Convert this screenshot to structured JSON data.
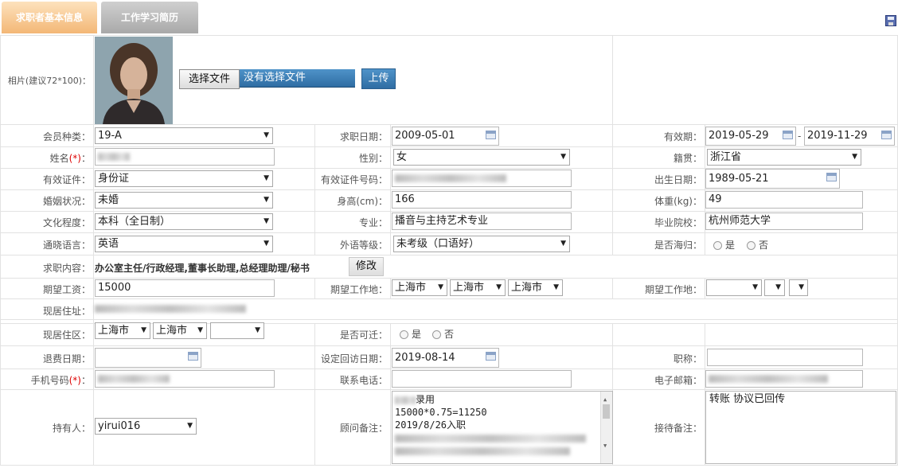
{
  "tabs": [
    {
      "label": "求职者基本信息",
      "active": true
    },
    {
      "label": "工作学习简历",
      "active": false
    }
  ],
  "colors": {
    "tab_active": "#f3b776",
    "tab_inactive": "#a9a9a9",
    "upload_btn": "#2f6da3"
  },
  "photo": {
    "label": "相片(建议72*100)：",
    "choose_file": "选择文件",
    "no_file": "没有选择文件",
    "upload": "上传"
  },
  "member_type": {
    "label": "会员种类：",
    "value": "19-A"
  },
  "apply_date": {
    "label": "求职日期：",
    "value": "2009-05-01"
  },
  "valid_period": {
    "label": "有效期：",
    "start": "2019-05-29",
    "sep": "-",
    "end": "2019-11-29"
  },
  "name": {
    "label": "姓名",
    "req": "(*)",
    "colon": "："
  },
  "gender": {
    "label": "性别：",
    "value": "女"
  },
  "hometown": {
    "label": "籍贯：",
    "value": "浙江省"
  },
  "id_type": {
    "label": "有效证件：",
    "value": "身份证"
  },
  "id_number": {
    "label": "有效证件号码："
  },
  "birth": {
    "label": "出生日期：",
    "value": "1989-05-21"
  },
  "marital": {
    "label": "婚姻状况：",
    "value": "未婚"
  },
  "height": {
    "label": "身高(cm)：",
    "value": "166"
  },
  "weight": {
    "label": "体重(kg)：",
    "value": "49"
  },
  "education": {
    "label": "文化程度：",
    "value": "本科（全日制）"
  },
  "major": {
    "label": "专业：",
    "value": "播音与主持艺术专业"
  },
  "school": {
    "label": "毕业院校：",
    "value": "杭州师范大学"
  },
  "language": {
    "label": "通晓语言：",
    "value": "英语"
  },
  "foreign_level": {
    "label": "外语等级：",
    "value": "未考级（口语好）"
  },
  "returnee": {
    "label": "是否海归：",
    "yes": "是",
    "no": "否"
  },
  "job_content": {
    "label": "求职内容：",
    "value": "办公室主任/行政经理,董事长助理,总经理助理/秘书",
    "edit": "修改"
  },
  "salary": {
    "label": "期望工资：",
    "value": "15000"
  },
  "work_place1": {
    "label": "期望工作地：",
    "values": [
      "上海市",
      "上海市",
      "上海市"
    ]
  },
  "work_place2": {
    "label": "期望工作地：",
    "values": [
      "",
      "",
      ""
    ]
  },
  "address": {
    "label": "现居住址："
  },
  "district": {
    "label": "现居住区：",
    "values": [
      "上海市",
      "上海市",
      ""
    ]
  },
  "relocate": {
    "label": "是否可迁：",
    "yes": "是",
    "no": "否"
  },
  "refund_date": {
    "label": "退费日期：",
    "value": ""
  },
  "revisit_date": {
    "label": "设定回访日期：",
    "value": "2019-08-14"
  },
  "title": {
    "label": "职称：",
    "value": ""
  },
  "mobile": {
    "label": "手机号码",
    "req": "(*)",
    "colon": "："
  },
  "phone": {
    "label": "联系电话：",
    "value": ""
  },
  "email": {
    "label": "电子邮箱："
  },
  "holder": {
    "label": "持有人：",
    "value": "yirui016"
  },
  "consultant_note": {
    "label": "顾问备注：",
    "lines": [
      "录用",
      "15000*0.75=11250",
      "2019/8/26入职"
    ]
  },
  "reception_note": {
    "label": "接待备注：",
    "value": "转账 协议已回传"
  }
}
